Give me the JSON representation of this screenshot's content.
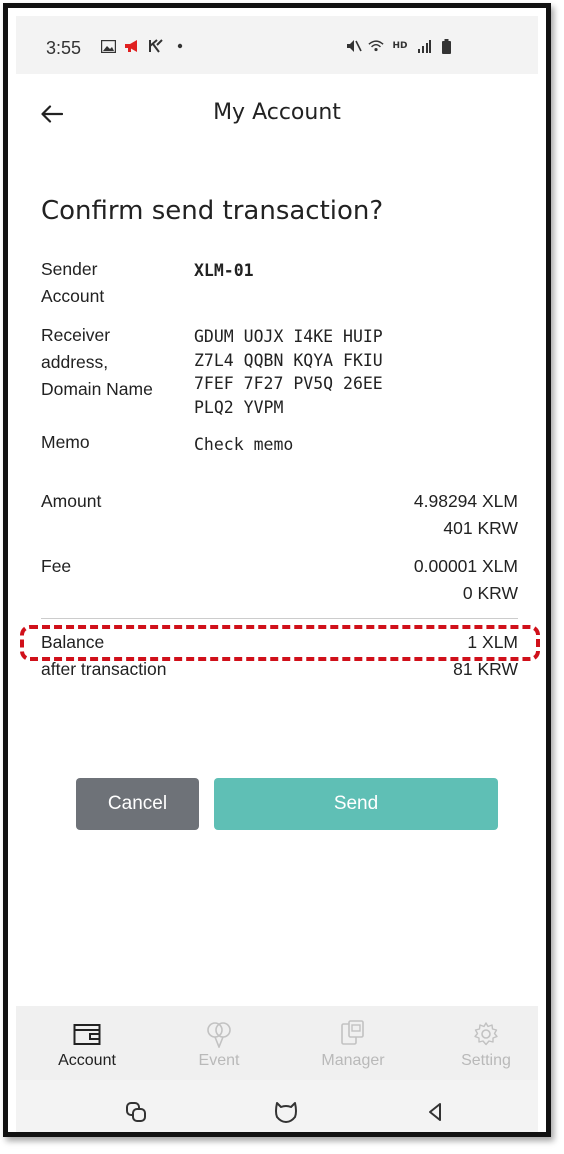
{
  "status_bar": {
    "time": "3:55",
    "left_icons": [
      "gallery-icon",
      "megaphone-icon",
      "k-app-icon",
      "dot-icon"
    ],
    "right_icons": [
      "mute-icon",
      "wifi-icon",
      "hd-voice-icon",
      "signal-icon",
      "battery-icon"
    ],
    "hd_text": "HD"
  },
  "header": {
    "title": "My Account",
    "back_icon": "arrow-left-icon"
  },
  "confirm": {
    "title": "Confirm send transaction?",
    "sender_label": "Sender\nAccount",
    "sender_value": "XLM-01",
    "receiver_label": "Receiver\naddress,\nDomain Name",
    "receiver_lines": [
      "GDUM UOJX I4KE HUIP",
      "Z7L4 QQBN KQYA FKIU",
      "7FEF 7F27 PV5Q 26EE",
      "PLQ2 YVPM"
    ],
    "memo_label": "Memo",
    "memo_value": "Check memo",
    "amount_label": "Amount",
    "amount_xlm": "4.98294 XLM",
    "amount_krw": "401 KRW",
    "fee_label": "Fee",
    "fee_xlm": "0.00001 XLM",
    "fee_krw": "0 KRW",
    "balance_label": "Balance\nafter transaction",
    "balance_xlm": "1 XLM",
    "balance_krw": "81 KRW"
  },
  "buttons": {
    "cancel": "Cancel",
    "send": "Send"
  },
  "tabs": [
    {
      "label": "Account",
      "icon": "wallet-icon",
      "active": true
    },
    {
      "label": "Event",
      "icon": "balloons-icon",
      "active": false
    },
    {
      "label": "Manager",
      "icon": "cards-icon",
      "active": false
    },
    {
      "label": "Setting",
      "icon": "gear-icon",
      "active": false
    }
  ],
  "system_nav": [
    "recent-apps-icon",
    "home-icon",
    "back-icon"
  ],
  "colors": {
    "highlight": "#d0101a",
    "send_button": "#5fbfb5",
    "cancel_button": "#6e7278"
  }
}
